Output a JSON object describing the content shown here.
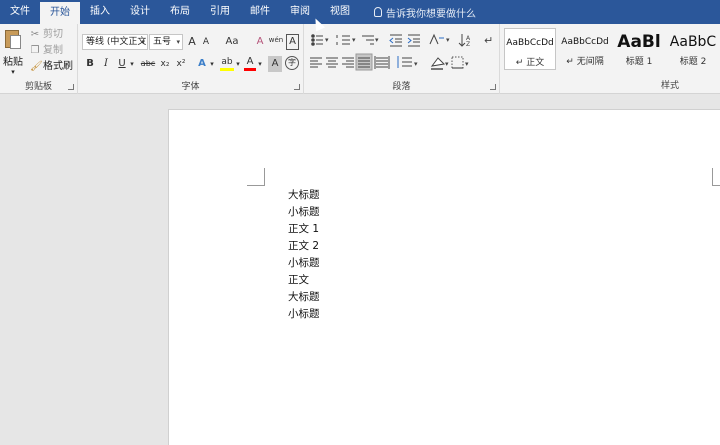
{
  "tabs": [
    {
      "label": "文件"
    },
    {
      "label": "开始",
      "active": true
    },
    {
      "label": "插入"
    },
    {
      "label": "设计"
    },
    {
      "label": "布局"
    },
    {
      "label": "引用"
    },
    {
      "label": "邮件"
    },
    {
      "label": "审阅"
    },
    {
      "label": "视图"
    }
  ],
  "tell_me": "告诉我你想要做什么",
  "clipboard": {
    "paste": "粘贴",
    "cut": "剪切",
    "copy": "复制",
    "format_painter": "格式刷",
    "label": "剪贴板"
  },
  "font": {
    "font_name": "等线 (中文正文)",
    "font_size": "五号",
    "grow": "A",
    "shrink": "A",
    "change_case": "Aa",
    "clear": "A",
    "phonetic": "wén",
    "border": "A",
    "bold": "B",
    "italic": "I",
    "underline": "U",
    "strike": "abc",
    "subscript": "x₂",
    "superscript": "x²",
    "text_effects": "A",
    "highlight": "ab",
    "font_color": "A",
    "char_shading": "A",
    "enclose": "字",
    "label": "字体"
  },
  "paragraph": {
    "label": "段落"
  },
  "styles": {
    "label": "样式",
    "items": [
      {
        "preview": "AaBbCcDd",
        "name": "↵ 正文"
      },
      {
        "preview": "AaBbCcDd",
        "name": "↵ 无间隔"
      },
      {
        "preview": "AaBl",
        "name": "标题 1"
      },
      {
        "preview": "AaBbC",
        "name": "标题 2"
      }
    ]
  },
  "document": {
    "lines": [
      "大标题",
      "小标题",
      "正文 1",
      "正文 2",
      "小标题",
      "正文",
      "大标题",
      "小标题"
    ]
  },
  "colors": {
    "ribbon_blue": "#2b579a",
    "ribbon_bg": "#f3f3f3",
    "canvas_bg": "#e6e6e6",
    "highlight_yellow": "#ffff00",
    "font_red": "#ff0000"
  }
}
